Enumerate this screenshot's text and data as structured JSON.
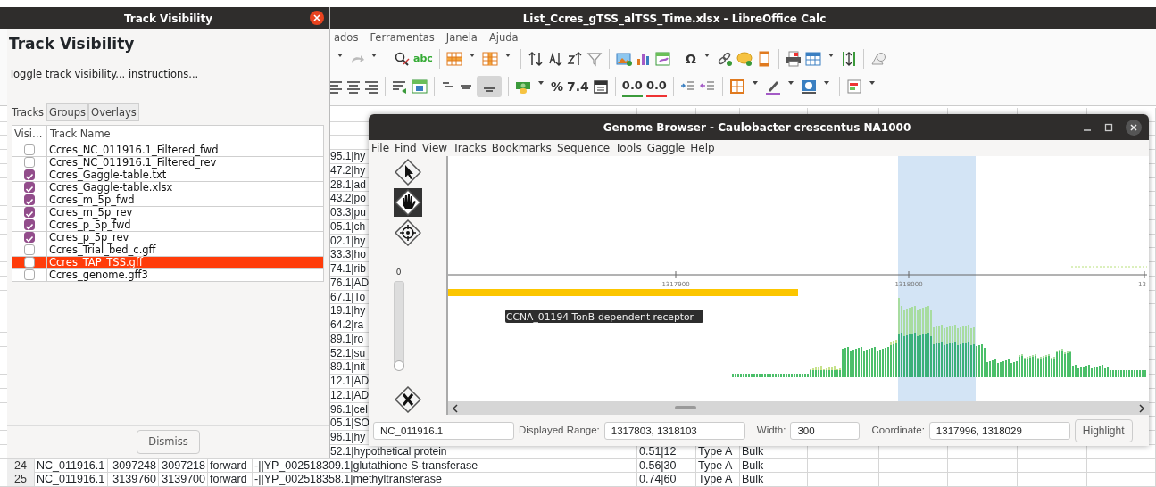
{
  "calc": {
    "title": "List_Ccres_gTSS_alTSS_Time.xlsx - LibreOffice Calc",
    "menu": [
      "ados",
      "Ferramentas",
      "Janela",
      "Ajuda"
    ],
    "toolbar_texts": {
      "spellcheck": "abc",
      "special_character": "Ω",
      "percent": "%",
      "number_format": "7.4",
      "add_decimal": "0.0",
      "remove_decimal": "0.0"
    },
    "sheet": {
      "fragments": [
        "95.1|hy",
        "47.2|hy",
        "28.1|ad",
        "43.2|po",
        "03.3|pu",
        "05.1|ch",
        "02.1|hy",
        "33.3|ho",
        "74.1|rib",
        "76.1|AD",
        "67.1|To",
        "19.1|hy",
        "64.2|ra",
        "89.1|ro",
        "52.1|su",
        "89.1|nit",
        "12.1|AD",
        "12.1|AD",
        "96.1|cel",
        "05.1|SO",
        "96.1|hy"
      ],
      "partial_row": {
        "column_5": "52.1|hypothetical protein",
        "column_6": "0.51|12",
        "column_7": "Type A",
        "column_8": "Bulk"
      },
      "rows": [
        {
          "number": "24",
          "cells": [
            "NC_011916.1",
            "3097248",
            "3097218",
            "forward",
            "-||YP_002518309.1|glutathione S-transferase",
            "0.56|30",
            "Type A",
            "Bulk"
          ]
        },
        {
          "number": "25",
          "cells": [
            "NC_011916.1",
            "3139760",
            "3139700",
            "forward",
            "-||YP_002518358.1|methyltransferase",
            "0.74|60",
            "Type A",
            "Bulk"
          ]
        }
      ]
    }
  },
  "track_visibility": {
    "title": "Track Visibility",
    "heading": "Track Visibility",
    "instructions": "Toggle track visibility... instructions...",
    "tabs": [
      {
        "label": "Tracks",
        "selected": true
      },
      {
        "label": "Groups",
        "selected": false
      },
      {
        "label": "Overlays",
        "selected": false
      }
    ],
    "columns": [
      "Visi…",
      "Track Name"
    ],
    "tracks": [
      {
        "name": "Ccres_NC_011916.1_Filtered_fwd",
        "visible": false,
        "selected": false
      },
      {
        "name": "Ccres_NC_011916.1_Filtered_rev",
        "visible": false,
        "selected": false
      },
      {
        "name": "Ccres_Gaggle-table.txt",
        "visible": true,
        "selected": false
      },
      {
        "name": "Ccres_Gaggle-table.xlsx",
        "visible": true,
        "selected": false
      },
      {
        "name": "Ccres_m_5p_fwd",
        "visible": true,
        "selected": false
      },
      {
        "name": "Ccres_m_5p_rev",
        "visible": true,
        "selected": false
      },
      {
        "name": "Ccres_p_5p_fwd",
        "visible": true,
        "selected": false
      },
      {
        "name": "Ccres_p_5p_rev",
        "visible": true,
        "selected": false
      },
      {
        "name": "Ccres_Trial_bed_c.gff",
        "visible": false,
        "selected": false
      },
      {
        "name": "Ccres_TAP_TSS.gff",
        "visible": false,
        "selected": true
      },
      {
        "name": "Ccres_genome.gff3",
        "visible": false,
        "selected": false
      }
    ],
    "dismiss": "Dismiss"
  },
  "genome_browser": {
    "title": "Genome Browser - Caulobacter crescentus NA1000",
    "menu": [
      "File",
      "Find",
      "View",
      "Tracks",
      "Bookmarks",
      "Sequence",
      "Tools",
      "Gaggle",
      "Help"
    ],
    "tools": [
      {
        "kind": "pointer",
        "selected": false
      },
      {
        "kind": "pan",
        "selected": true
      },
      {
        "kind": "target",
        "selected": false
      }
    ],
    "zoom_slider": {
      "label": "0",
      "level": 0
    },
    "ruler_ticks": [
      "1317900",
      "1318000",
      "13"
    ],
    "gene": {
      "label": "CCNA_01194 TonB-dependent receptor"
    },
    "region_highlighted": true,
    "sequence": {
      "value": "NC_011916.1"
    },
    "displayed_range": {
      "label": "Displayed Range:",
      "value": "1317803, 1318103"
    },
    "width": {
      "label": "Width:",
      "value": "300"
    },
    "coordinate": {
      "label": "Coordinate:",
      "value": "1317996, 1318029"
    },
    "highlight_button": "Highlight"
  }
}
